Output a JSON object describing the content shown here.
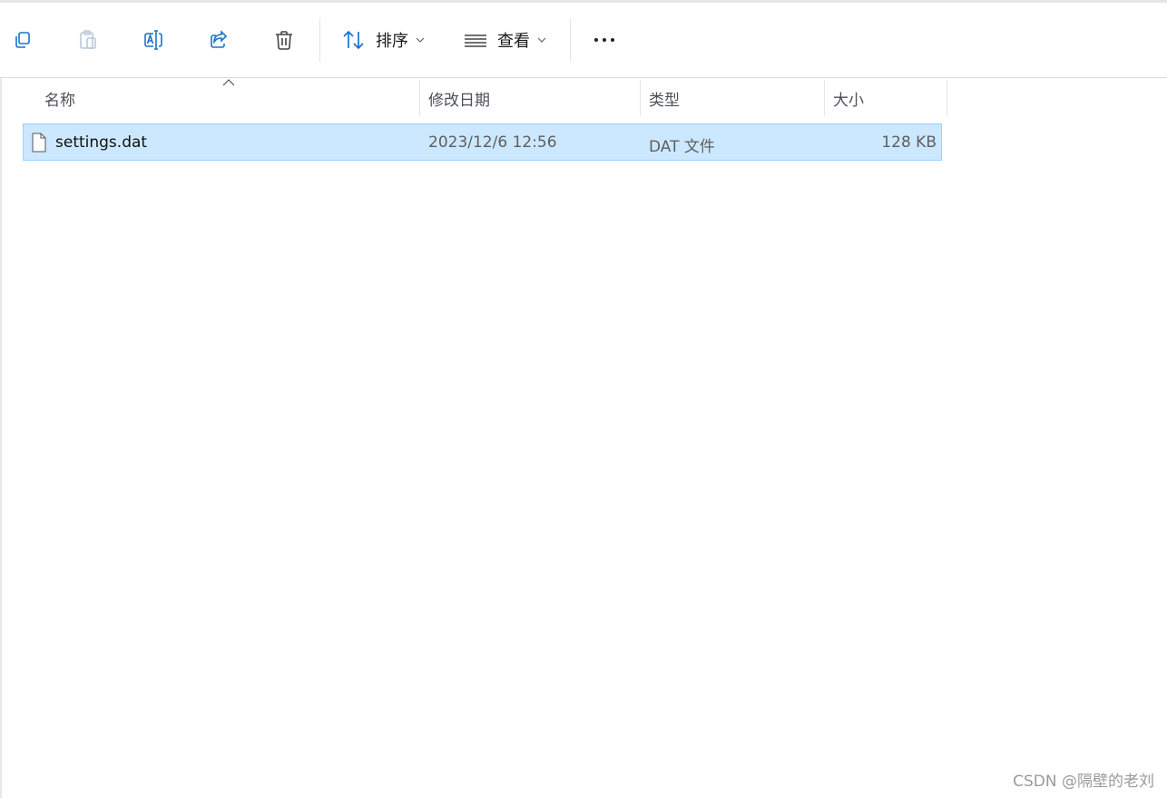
{
  "toolbar": {
    "icons": [
      "copy-icon",
      "paste-icon",
      "rename-icon",
      "share-icon",
      "delete-icon"
    ],
    "sort_label": "排序",
    "view_label": "查看",
    "more_label": "more-options"
  },
  "columns": {
    "name": "名称",
    "modified": "修改日期",
    "type": "类型",
    "size": "大小"
  },
  "files": [
    {
      "name": "settings.dat",
      "modified": "2023/12/6 12:56",
      "type": "DAT 文件",
      "size": "128 KB",
      "selected": true
    }
  ],
  "watermark": "CSDN @隔壁的老刘",
  "colors": {
    "selection_bg": "#cce8ff",
    "selection_border": "#99d1ff",
    "accent": "#1a73c8"
  }
}
